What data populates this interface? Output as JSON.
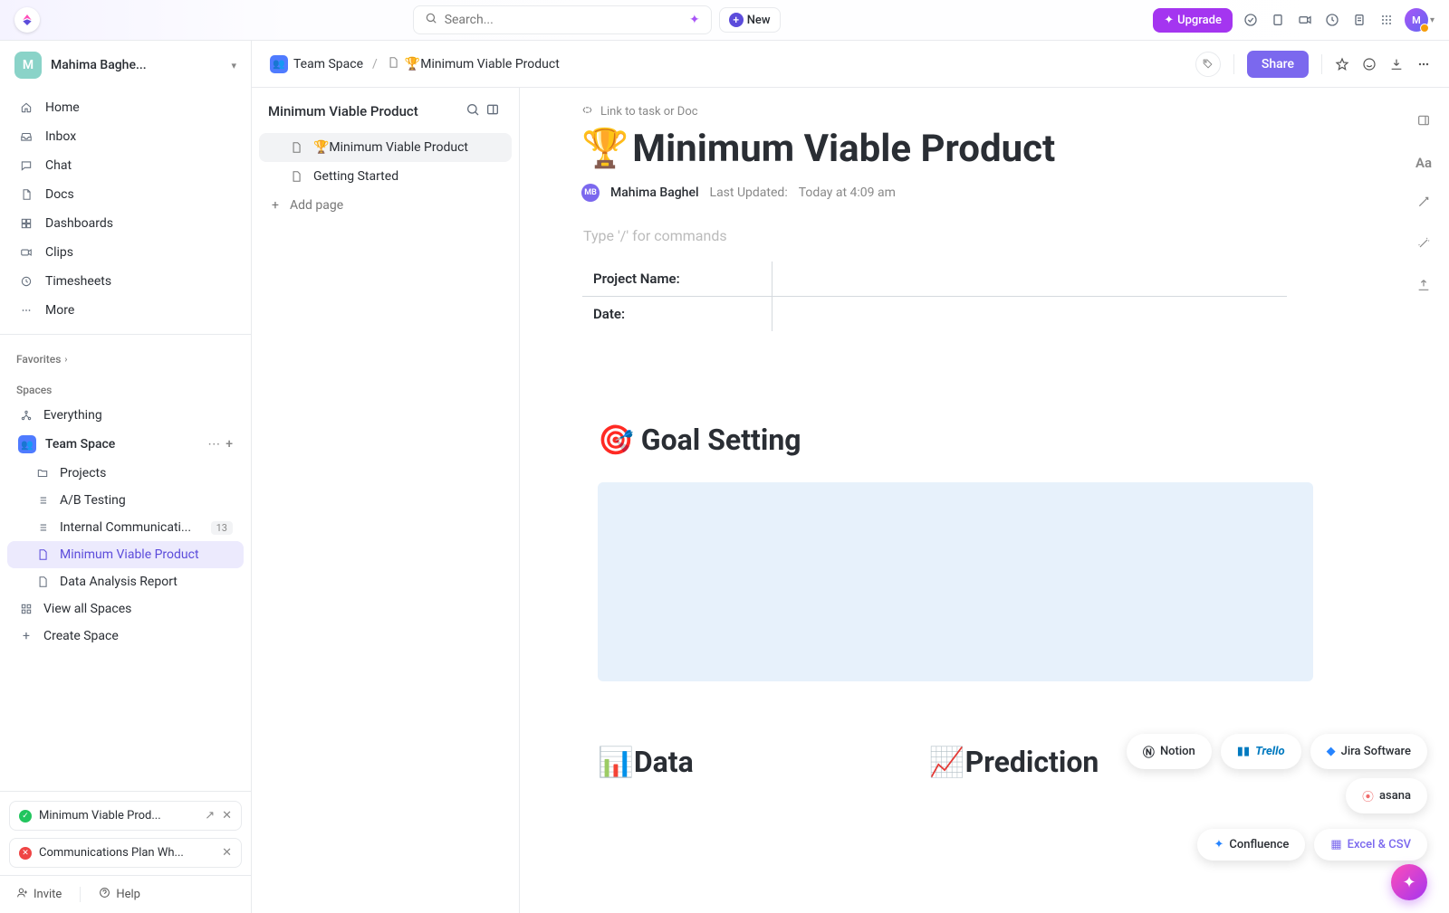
{
  "topbar": {
    "search_placeholder": "Search...",
    "new_label": "New",
    "upgrade_label": "Upgrade",
    "avatar_initial": "M"
  },
  "workspace": {
    "initial": "M",
    "name": "Mahima Baghe..."
  },
  "nav": {
    "home": "Home",
    "inbox": "Inbox",
    "chat": "Chat",
    "docs": "Docs",
    "dashboards": "Dashboards",
    "clips": "Clips",
    "timesheets": "Timesheets",
    "more": "More"
  },
  "sections": {
    "favorites": "Favorites",
    "spaces": "Spaces"
  },
  "tree": {
    "everything": "Everything",
    "team_space": "Team Space",
    "projects": "Projects",
    "ab_testing": "A/B Testing",
    "internal_comm": "Internal Communicati...",
    "internal_comm_count": "13",
    "mvp": "Minimum Viable Product",
    "data_report": "Data Analysis Report",
    "view_all": "View all Spaces",
    "create_space": "Create Space"
  },
  "recent": {
    "item1": "Minimum Viable Prod...",
    "item2": "Communications Plan Wh..."
  },
  "footer": {
    "invite": "Invite",
    "help": "Help"
  },
  "panel": {
    "title": "Minimum Viable Product",
    "item1": "🏆Minimum Viable Product",
    "item2": "Getting Started",
    "add_page": "Add page"
  },
  "breadcrumb": {
    "space": "Team Space",
    "doc": "🏆Minimum Viable Product"
  },
  "header_actions": {
    "share": "Share"
  },
  "doc": {
    "link_hint": "Link to task or Doc",
    "title_emoji": "🏆",
    "title": "Minimum Viable Product",
    "author_initials": "MB",
    "author": "Mahima Baghel",
    "updated_label": "Last Updated:",
    "updated_time": "Today at 4:09 am",
    "command_hint": "Type '/' for commands",
    "row1_label": "Project Name:",
    "row2_label": "Date:",
    "h2_goal": "🎯 Goal Setting",
    "h2_data": "📊Data",
    "h2_pred": "📈Prediction"
  },
  "pills": {
    "notion": "Notion",
    "trello": "Trello",
    "jira": "Jira Software",
    "asana": "asana",
    "confluence": "Confluence",
    "excel": "Excel & CSV"
  }
}
